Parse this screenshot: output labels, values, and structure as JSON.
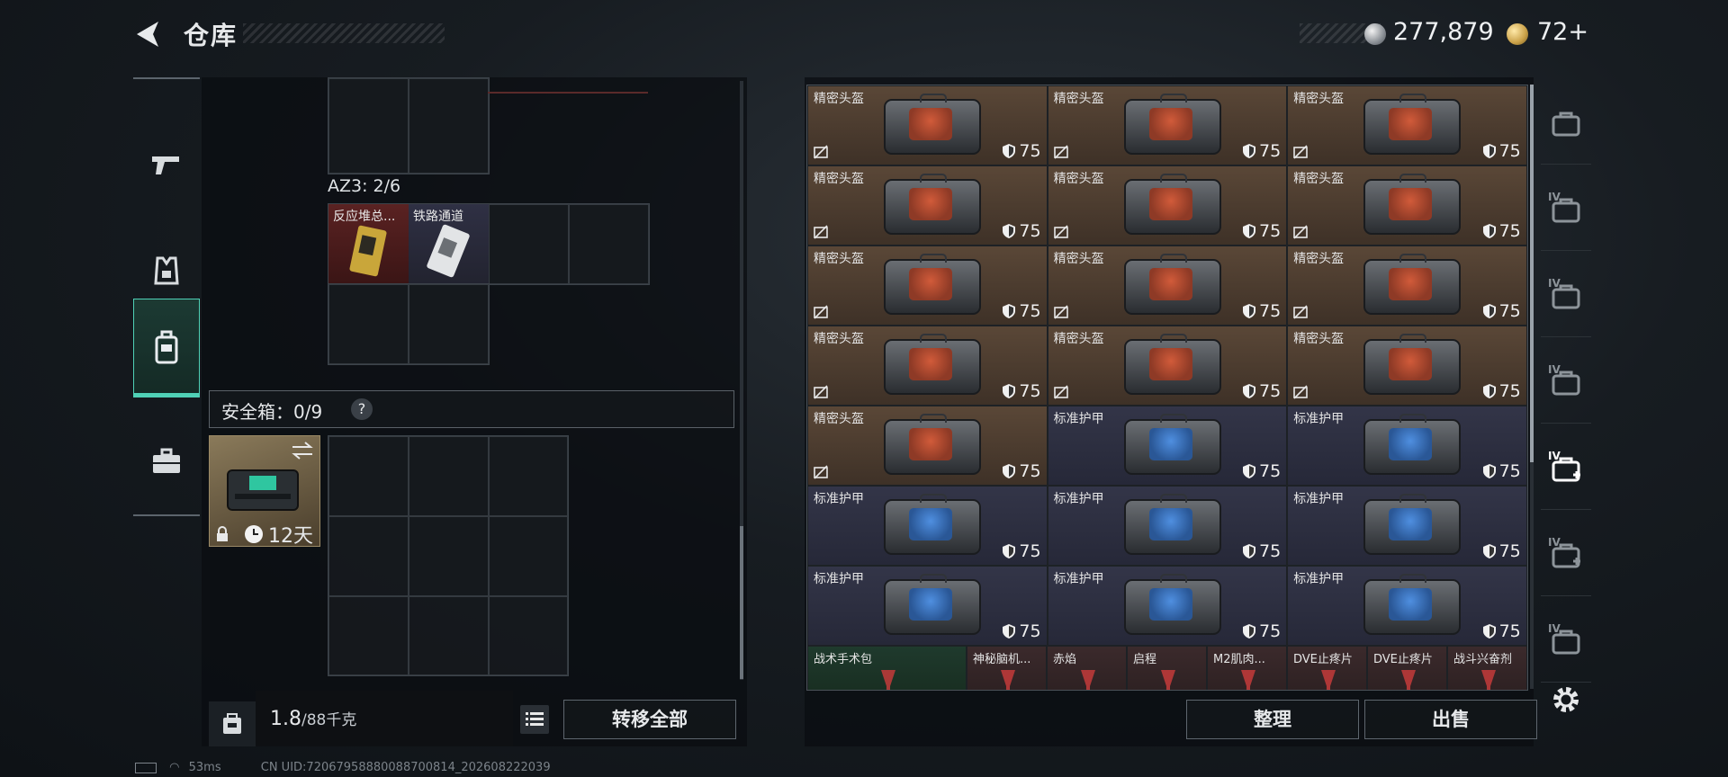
{
  "header": {
    "title": "仓库",
    "money": "277,879",
    "gold": "72+"
  },
  "left_tabs": [
    "gun-icon",
    "vest-icon",
    "backpack-icon",
    "case-icon"
  ],
  "left_panel": {
    "az3_label": "AZ3: 2/6",
    "items": [
      {
        "name": "反应堆总..."
      },
      {
        "name": "铁路通道"
      }
    ],
    "safe_box_label": "安全箱：0/9",
    "safe_help": "?",
    "safe_days": "12天",
    "weight_value": "1.8",
    "weight_unit": "/88千克",
    "transfer_all": "转移全部"
  },
  "stash": {
    "slots": [
      {
        "name": "精密头盔",
        "value": "75",
        "type": "helmet"
      },
      {
        "name": "精密头盔",
        "value": "75",
        "type": "helmet"
      },
      {
        "name": "精密头盔",
        "value": "75",
        "type": "helmet"
      },
      {
        "name": "精密头盔",
        "value": "75",
        "type": "helmet"
      },
      {
        "name": "精密头盔",
        "value": "75",
        "type": "helmet"
      },
      {
        "name": "精密头盔",
        "value": "75",
        "type": "helmet"
      },
      {
        "name": "精密头盔",
        "value": "75",
        "type": "helmet"
      },
      {
        "name": "精密头盔",
        "value": "75",
        "type": "helmet"
      },
      {
        "name": "精密头盔",
        "value": "75",
        "type": "helmet"
      },
      {
        "name": "精密头盔",
        "value": "75",
        "type": "helmet"
      },
      {
        "name": "精密头盔",
        "value": "75",
        "type": "helmet"
      },
      {
        "name": "精密头盔",
        "value": "75",
        "type": "helmet"
      },
      {
        "name": "精密头盔",
        "value": "75",
        "type": "helmet"
      },
      {
        "name": "标准护甲",
        "value": "75",
        "type": "armor"
      },
      {
        "name": "标准护甲",
        "value": "75",
        "type": "armor"
      },
      {
        "name": "标准护甲",
        "value": "75",
        "type": "armor"
      },
      {
        "name": "标准护甲",
        "value": "75",
        "type": "armor"
      },
      {
        "name": "标准护甲",
        "value": "75",
        "type": "armor"
      },
      {
        "name": "标准护甲",
        "value": "75",
        "type": "armor"
      },
      {
        "name": "标准护甲",
        "value": "75",
        "type": "armor"
      },
      {
        "name": "标准护甲",
        "value": "75",
        "type": "armor"
      }
    ],
    "small_items": [
      {
        "name": "战术手术包",
        "wide": true,
        "color": "green"
      },
      {
        "name": "神秘脑机..."
      },
      {
        "name": "赤焰"
      },
      {
        "name": "启程"
      },
      {
        "name": "M2肌肉..."
      },
      {
        "name": "DVE止疼片"
      },
      {
        "name": "DVE止疼片"
      },
      {
        "name": "战斗兴奋剂"
      }
    ],
    "sort_label": "整理",
    "sell_label": "出售"
  },
  "right_tabs": [
    "helmet-filter-icon",
    "armor-filter-icon",
    "vest-filter-icon",
    "vest-filter-icon-2",
    "medkit-filter-icon",
    "medkit-filter-icon-2",
    "misc-filter-icon"
  ],
  "right_tab_levels": [
    "",
    "IV",
    "IV",
    "IV",
    "IV",
    "IV",
    "IV"
  ],
  "status": {
    "ping": "53ms",
    "uid": "CN UID:72067958880088700814_202608222039"
  },
  "colors": {
    "accent": "#4fd1b6",
    "helmet_bg": "#4e3e31",
    "armor_bg": "#2f3144"
  }
}
